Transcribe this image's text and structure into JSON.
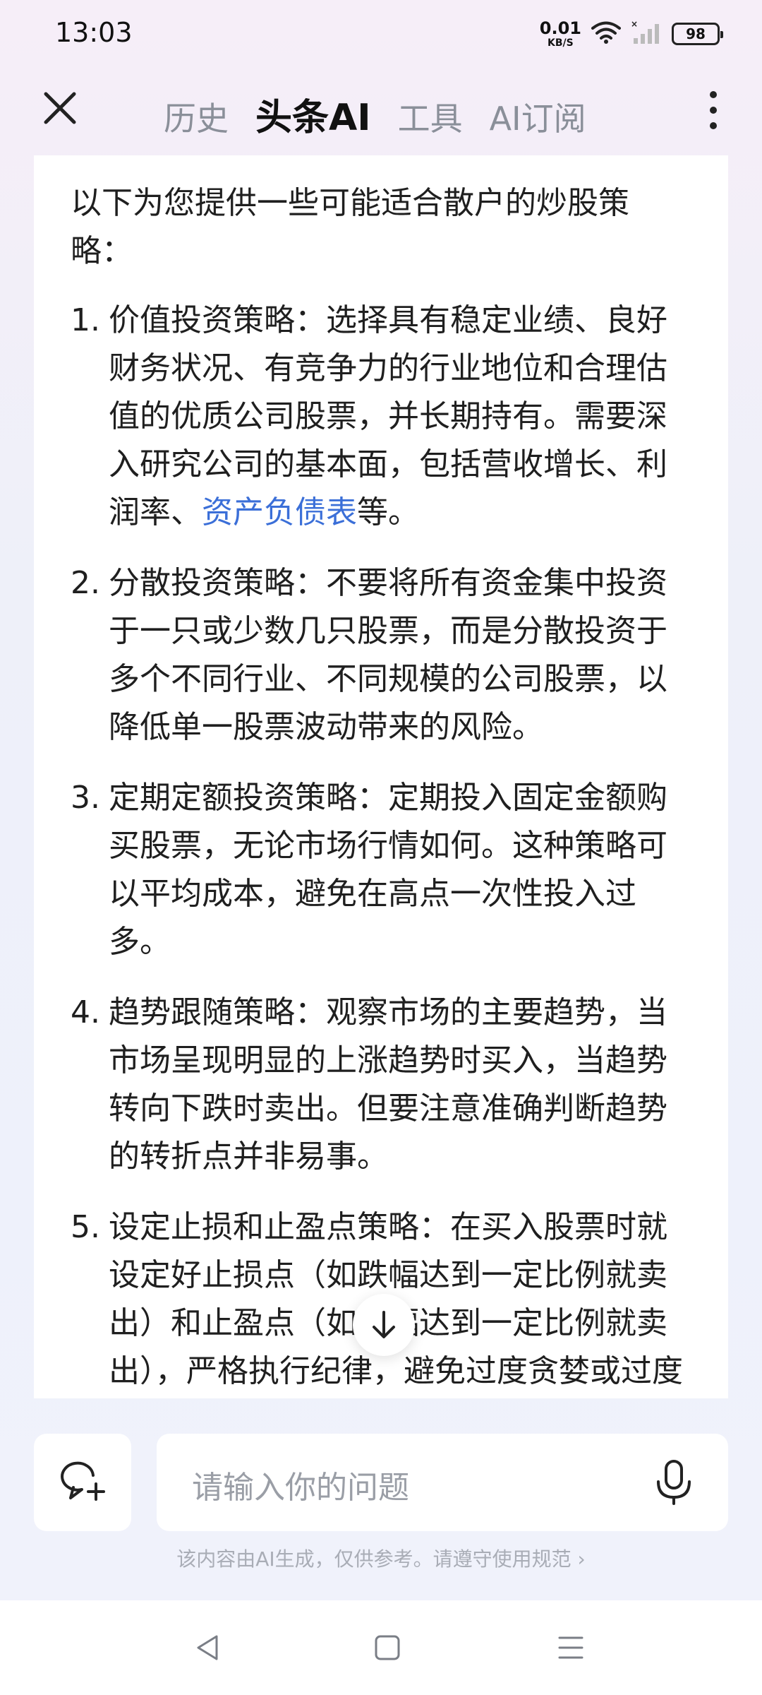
{
  "status_bar": {
    "time": "13:03",
    "net_speed": "0.01",
    "net_unit": "KB/S",
    "battery": "98"
  },
  "header": {
    "tabs": [
      {
        "label": "历史",
        "active": false
      },
      {
        "label": "头条AI",
        "active": true
      },
      {
        "label": "工具",
        "active": false
      },
      {
        "label": "AI订阅",
        "active": false
      }
    ]
  },
  "content": {
    "intro": "以下为您提供一些可能适合散户的炒股策略：",
    "items": [
      {
        "num": "1.",
        "text_before": "价值投资策略：选择具有稳定业绩、良好财务状况、有竞争力的行业地位和合理估值的优质公司股票，并长期持有。需要深入研究公司的基本面，包括营收增长、利润率、",
        "link": "资产负债表",
        "text_after": "等。"
      },
      {
        "num": "2.",
        "text": "分散投资策略：不要将所有资金集中投资于一只或少数几只股票，而是分散投资于多个不同行业、不同规模的公司股票，以降低单一股票波动带来的风险。"
      },
      {
        "num": "3.",
        "text": "定期定额投资策略：定期投入固定金额购买股票，无论市场行情如何。这种策略可以平均成本，避免在高点一次性投入过多。"
      },
      {
        "num": "4.",
        "text": "趋势跟随策略：观察市场的主要趋势，当市场呈现明显的上涨趋势时买入，当趋势转向下跌时卖出。但要注意准确判断趋势的转折点并非易事。"
      },
      {
        "num": "5.",
        "text": "设定止损和止盈点策略：在买入股票时就设定好止损点（如跌幅达到一定比例就卖出）和止盈点（如涨幅达到一定比例就卖出），严格执行纪律，避免过度贪婪或过度恐惧。"
      }
    ]
  },
  "input": {
    "placeholder": "请输入你的问题"
  },
  "disclaimer": "该内容由AI生成，仅供参考。请遵守使用规范 ›",
  "colors": {
    "link": "#3b6fd8",
    "background_top": "#f6eef8",
    "background_bottom": "#eef1fb",
    "muted_text": "#8a8f99"
  },
  "icons": {
    "close": "close-icon",
    "more": "more-vertical-icon",
    "scroll_down": "arrow-down-icon",
    "new_chat": "new-chat-icon",
    "mic": "microphone-icon",
    "wifi": "wifi-icon",
    "signal": "signal-icon",
    "nav_back": "back-triangle-icon",
    "nav_home": "home-square-icon",
    "nav_recent": "recent-menu-icon"
  }
}
